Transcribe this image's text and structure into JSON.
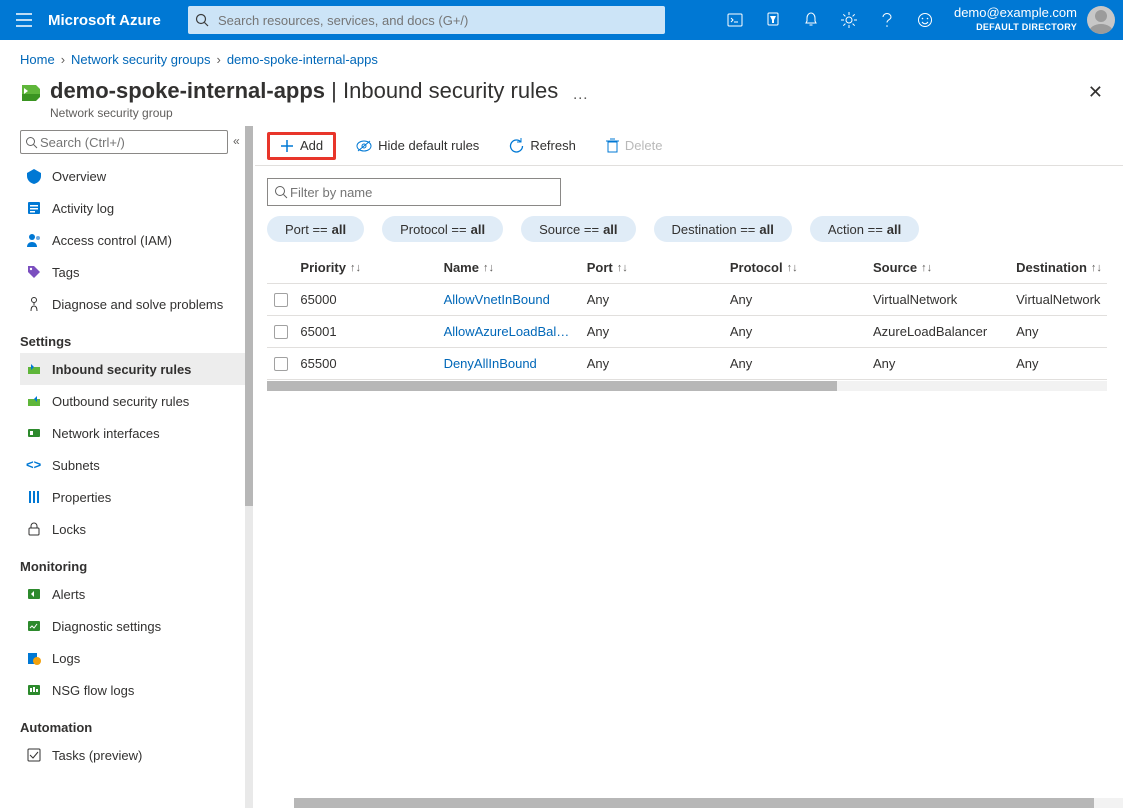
{
  "topbar": {
    "brand": "Microsoft Azure",
    "search_placeholder": "Search resources, services, and docs (G+/)",
    "account_email": "demo@example.com",
    "account_directory": "DEFAULT DIRECTORY"
  },
  "breadcrumb": [
    {
      "label": "Home"
    },
    {
      "label": "Network security groups"
    },
    {
      "label": "demo-spoke-internal-apps"
    }
  ],
  "title": {
    "resource": "demo-spoke-internal-apps",
    "section": "Inbound security rules",
    "type": "Network security group",
    "separator": " | "
  },
  "sidebar": {
    "search_placeholder": "Search (Ctrl+/)",
    "sections": [
      {
        "type": "items",
        "items": [
          {
            "k": "overview",
            "label": "Overview"
          },
          {
            "k": "activity",
            "label": "Activity log"
          },
          {
            "k": "iam",
            "label": "Access control (IAM)"
          },
          {
            "k": "tags",
            "label": "Tags"
          },
          {
            "k": "diag",
            "label": "Diagnose and solve problems"
          }
        ]
      },
      {
        "type": "header",
        "label": "Settings"
      },
      {
        "type": "items",
        "items": [
          {
            "k": "inbound",
            "label": "Inbound security rules",
            "selected": true
          },
          {
            "k": "outbound",
            "label": "Outbound security rules"
          },
          {
            "k": "nic",
            "label": "Network interfaces"
          },
          {
            "k": "subnets",
            "label": "Subnets"
          },
          {
            "k": "props",
            "label": "Properties"
          },
          {
            "k": "locks",
            "label": "Locks"
          }
        ]
      },
      {
        "type": "header",
        "label": "Monitoring"
      },
      {
        "type": "items",
        "items": [
          {
            "k": "alerts",
            "label": "Alerts"
          },
          {
            "k": "diagset",
            "label": "Diagnostic settings"
          },
          {
            "k": "logs",
            "label": "Logs"
          },
          {
            "k": "flow",
            "label": "NSG flow logs"
          }
        ]
      },
      {
        "type": "header",
        "label": "Automation"
      },
      {
        "type": "items",
        "items": [
          {
            "k": "tasks",
            "label": "Tasks (preview)"
          }
        ]
      }
    ]
  },
  "toolbar": {
    "add": "Add",
    "hide": "Hide default rules",
    "refresh": "Refresh",
    "delete": "Delete"
  },
  "filters": {
    "filter_placeholder": "Filter by name",
    "pills": [
      {
        "label": "Port",
        "value": "all"
      },
      {
        "label": "Protocol",
        "value": "all"
      },
      {
        "label": "Source",
        "value": "all"
      },
      {
        "label": "Destination",
        "value": "all"
      },
      {
        "label": "Action",
        "value": "all"
      }
    ]
  },
  "table": {
    "columns": [
      "Priority",
      "Name",
      "Port",
      "Protocol",
      "Source",
      "Destination"
    ],
    "rows": [
      {
        "priority": "65000",
        "name": "AllowVnetInBound",
        "port": "Any",
        "protocol": "Any",
        "source": "VirtualNetwork",
        "destination": "VirtualNetwork"
      },
      {
        "priority": "65001",
        "name": "AllowAzureLoadBalan...",
        "port": "Any",
        "protocol": "Any",
        "source": "AzureLoadBalancer",
        "destination": "Any"
      },
      {
        "priority": "65500",
        "name": "DenyAllInBound",
        "port": "Any",
        "protocol": "Any",
        "source": "Any",
        "destination": "Any"
      }
    ]
  }
}
